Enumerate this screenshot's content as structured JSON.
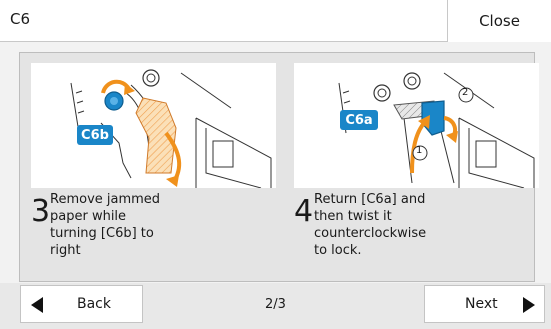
{
  "header": {
    "title": "C6",
    "close_label": "Close"
  },
  "steps": [
    {
      "number": "3",
      "tag": "C6b",
      "text": "Remove jammed\npaper while\nturning [C6b] to\nright"
    },
    {
      "number": "4",
      "tag": "C6a",
      "circle1": "1",
      "circle2": "2",
      "text": "Return [C6a] and\nthen twist it\ncounterclockwise\nto lock."
    }
  ],
  "footer": {
    "back_label": "Back",
    "next_label": "Next",
    "page": "2/3"
  },
  "colors": {
    "accent": "#1a86c8",
    "arrow": "#f0911c",
    "hatch": "#f7c27a"
  }
}
